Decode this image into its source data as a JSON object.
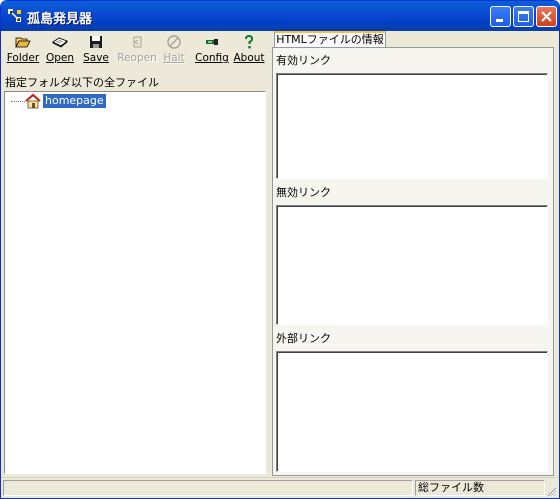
{
  "window": {
    "title": "孤島発見器"
  },
  "toolbar": {
    "folder": "Folder",
    "open": "Open",
    "save": "Save",
    "reopen": "Reopen",
    "halt": "Halt",
    "config": "Config",
    "about": "About"
  },
  "left_panel": {
    "header": "指定フォルダ以下の全ファイル",
    "tree_root": "homepage"
  },
  "right_panel": {
    "tab": "HTMLファイルの情報",
    "valid_links_label": "有効リンク",
    "invalid_links_label": "無効リンク",
    "external_links_label": "外部リンク"
  },
  "statusbar": {
    "pane2": "総ファイル数"
  },
  "icons": {
    "folder": "folder-open-icon",
    "open": "open-book-icon",
    "save": "floppy-disk-icon",
    "reopen": "reopen-icon",
    "halt": "halt-icon",
    "config": "wrench-icon",
    "about": "question-mark-icon",
    "tree_root": "house-icon"
  }
}
